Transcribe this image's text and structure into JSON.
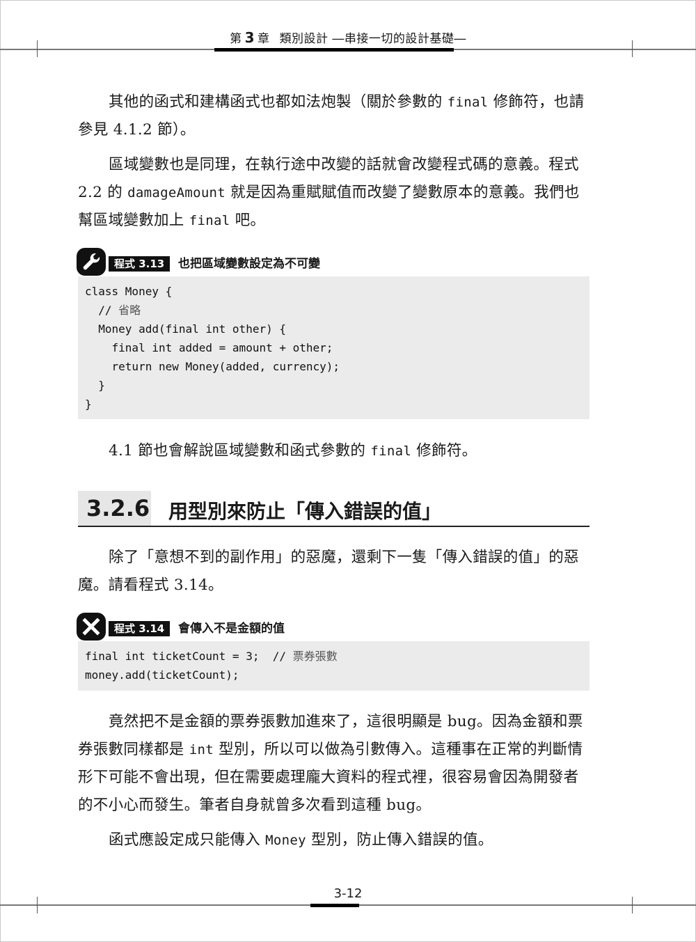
{
  "header": {
    "chapter_prefix": "第",
    "chapter_number": "3",
    "chapter_suffix": "章",
    "chapter_title": "類別設計 ―串接一切的設計基礎―"
  },
  "paragraphs": {
    "p1": {
      "a": "其他的函式和建構函式也都如法炮製（關於參數的 ",
      "code": "final",
      "b": " 修飾符，也請參見 4.1.2 節）。"
    },
    "p2": {
      "a": "區域變數也是同理，在執行途中改變的話就會改變程式碼的意義。程式 2.2 的 ",
      "code1": "damageAmount",
      "b": " 就是因為重賦賦值而改變了變數原本的意義。我們也幫區域變數加上 ",
      "code2": "final",
      "c": " 吧。"
    },
    "p3": {
      "a": "4.1 節也會解說區域變數和函式參數的 ",
      "code": "final",
      "b": " 修飾符。"
    },
    "p4": {
      "a": "除了「意想不到的副作用」的惡魔，還剩下一隻「傳入錯誤的值」的惡魔。請看程式 3.14。"
    },
    "p5": {
      "a": "竟然把不是金額的票券張數加進來了，這很明顯是 bug。因為金額和票券張數同樣都是 ",
      "code": "int",
      "b": " 型別，所以可以做為引數傳入。這種事在正常的判斷情形下可能不會出現，但在需要處理龐大資料的程式裡，很容易會因為開發者的不小心而發生。筆者自身就曾多次看到這種 bug。"
    },
    "p6": {
      "a": "函式應設定成只能傳入 ",
      "code": "Money",
      "b": " 型別，防止傳入錯誤的值。"
    }
  },
  "listings": [
    {
      "icon": "wrench-icon",
      "label": "程式 3.13",
      "title": "也把區域變數設定為不可變",
      "lines": [
        {
          "code": "class Money {",
          "comment": ""
        },
        {
          "code": "  // ",
          "comment": "省略"
        },
        {
          "code": "  Money add(final int other) {",
          "comment": ""
        },
        {
          "code": "    final int added = amount + other;",
          "comment": ""
        },
        {
          "code": "    return new Money(added, currency);",
          "comment": ""
        },
        {
          "code": "  }",
          "comment": ""
        },
        {
          "code": "}",
          "comment": ""
        }
      ]
    },
    {
      "icon": "cross-icon",
      "label": "程式 3.14",
      "title": "會傳入不是金額的值",
      "lines": [
        {
          "code": "final int ticketCount = 3;  // ",
          "comment": "票券張數"
        },
        {
          "code": "money.add(ticketCount);",
          "comment": ""
        }
      ]
    }
  ],
  "section": {
    "number": "3.2.6",
    "title": "用型別來防止「傳入錯誤的值」"
  },
  "footer": {
    "page_number": "3-12"
  }
}
